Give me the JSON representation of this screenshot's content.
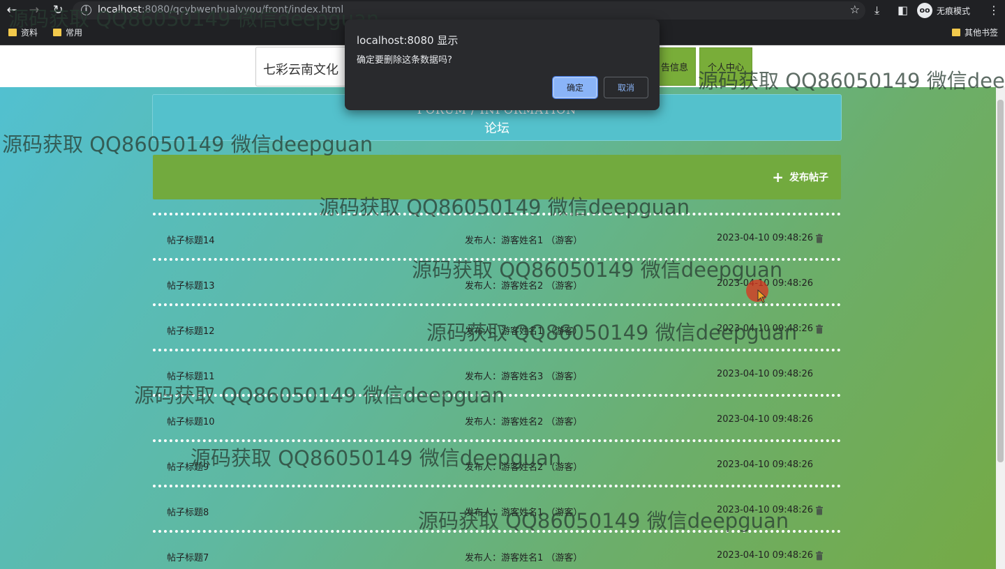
{
  "browser": {
    "url_host": "localhost",
    "url_rest": ":8080/qcybwenhualvyou/front/index.html",
    "incognito_label": "无痕模式",
    "bookmarks": [
      "资料",
      "常用"
    ],
    "other_bookmarks": "其他书签"
  },
  "header": {
    "site_title": "七彩云南文化",
    "nav": [
      {
        "label": "告信息"
      },
      {
        "label": "个人中心"
      }
    ]
  },
  "forum": {
    "title_en": "FORUM / INFORMATION",
    "title_cn": "论坛",
    "publish_label": "发布帖子",
    "posts": [
      {
        "title": "帖子标题14",
        "author": "发布人：游客姓名1 （游客）",
        "time": "2023-04-10 09:48:26",
        "deletable": true
      },
      {
        "title": "帖子标题13",
        "author": "发布人：游客姓名2 （游客）",
        "time": "2023-04-10 09:48:26",
        "deletable": false
      },
      {
        "title": "帖子标题12",
        "author": "发布人：游客姓名1 （游客）",
        "time": "2023-04-10 09:48:26",
        "deletable": true
      },
      {
        "title": "帖子标题11",
        "author": "发布人：游客姓名3 （游客）",
        "time": "2023-04-10 09:48:26",
        "deletable": false
      },
      {
        "title": "帖子标题10",
        "author": "发布人：游客姓名2 （游客）",
        "time": "2023-04-10 09:48:26",
        "deletable": false
      },
      {
        "title": "帖子标题9",
        "author": "发布人：游客姓名2 （游客）",
        "time": "2023-04-10 09:48:26",
        "deletable": false
      },
      {
        "title": "帖子标题8",
        "author": "发布人：游客姓名1 （游客）",
        "time": "2023-04-10 09:48:26",
        "deletable": true
      },
      {
        "title": "帖子标题7",
        "author": "发布人：游客姓名1 （游客）",
        "time": "2023-04-10 09:48:26",
        "deletable": true
      }
    ]
  },
  "dialog": {
    "title": "localhost:8080 显示",
    "message": "确定要删除这条数据吗?",
    "ok_label": "确定",
    "cancel_label": "取消"
  },
  "watermark": "源码获取 QQ86050149 微信deepguan"
}
